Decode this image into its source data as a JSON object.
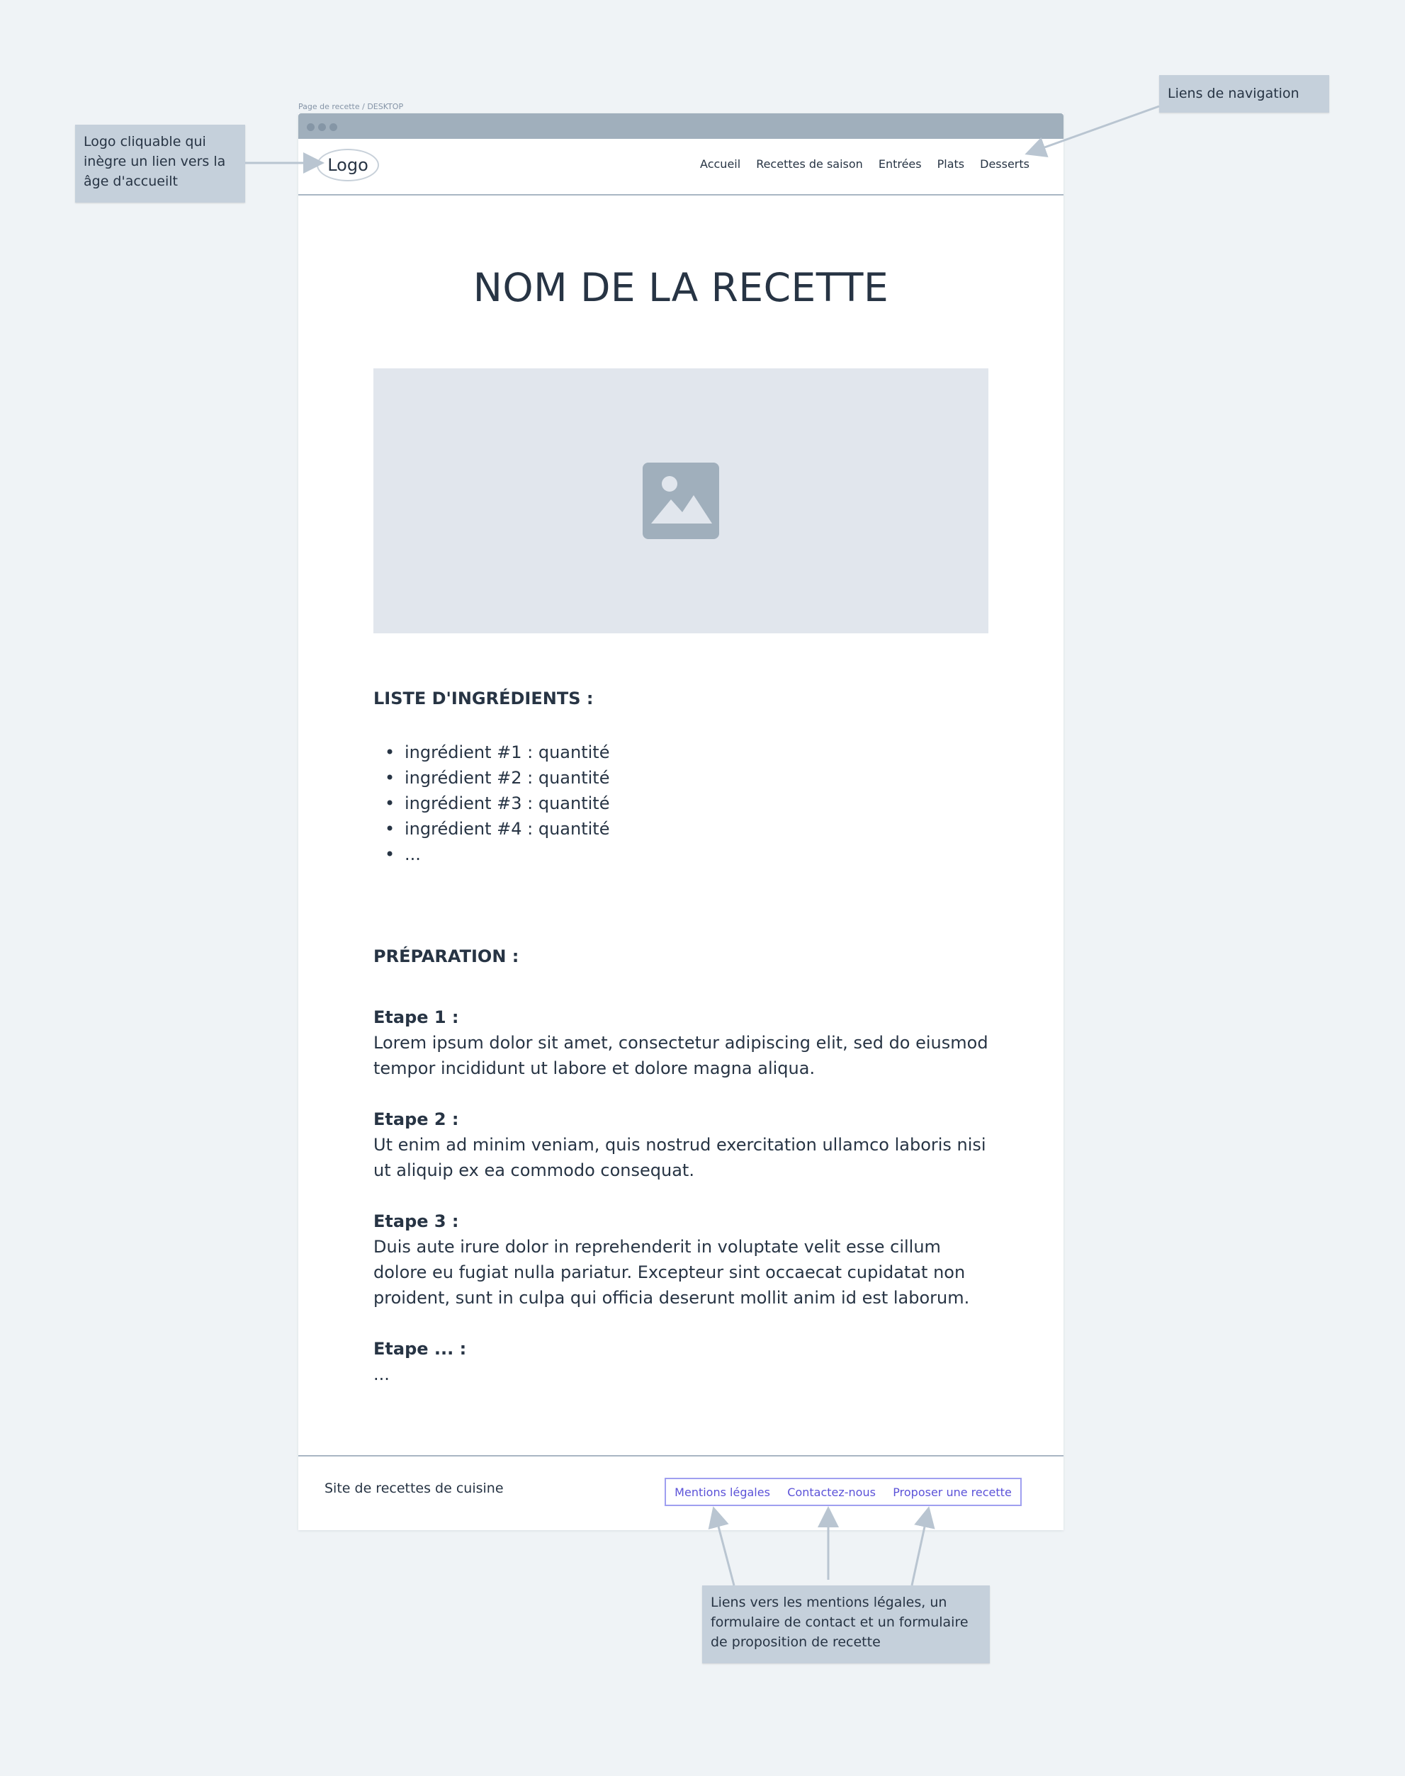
{
  "frame": {
    "label": "Page de recette / DESKTOP"
  },
  "header": {
    "logo": "Logo",
    "nav": [
      "Accueil",
      "Recettes de saison",
      "Entrées",
      "Plats",
      "Desserts"
    ]
  },
  "recipe": {
    "title": "NOM DE LA RECETTE",
    "image_icon": "image-placeholder-icon",
    "ingredients_heading": "LISTE D'INGRÉDIENTS :",
    "ingredients": [
      "ingrédient #1 : quantité",
      "ingrédient #2 : quantité",
      "ingrédient #3 : quantité",
      "ingrédient #4 : quantité",
      "..."
    ],
    "preparation_heading": "PRÉPARATION :",
    "steps": [
      {
        "title": "Etape 1 :",
        "text": "Lorem ipsum dolor sit amet, consectetur adipiscing elit, sed do eiusmod tempor incididunt ut labore et dolore magna aliqua."
      },
      {
        "title": "Etape 2 :",
        "text": "Ut enim ad minim  veniam, quis nostrud exercitation ullamco laboris nisi ut aliquip ex ea  commodo consequat."
      },
      {
        "title": "Etape 3 :",
        "text": "Duis aute irure dolor in reprehenderit in voluptate  velit esse cillum dolore eu fugiat nulla pariatur. Excepteur sint  occaecat cupidatat non proident, sunt in culpa qui officia deserunt  mollit anim id est laborum."
      },
      {
        "title": "Etape ... :",
        "text": "..."
      }
    ]
  },
  "footer": {
    "text": "Site de recettes de cuisine",
    "links": [
      "Mentions légales",
      "Contactez-nous",
      "Proposer une recette"
    ]
  },
  "annotations": {
    "logo_note": "Logo cliquable qui inègre un lien vers la âge d'accueilt",
    "nav_note": "Liens de navigation",
    "footer_note": "Liens vers les mentions légales, un formulaire de contact et un formulaire de proposition de recette"
  },
  "colors": {
    "background": "#eff3f6",
    "browser_bar": "#a0afbc",
    "image_placeholder": "#e1e6ed",
    "footer_link": "#5b52d8",
    "annotation": "#c5d0db"
  }
}
